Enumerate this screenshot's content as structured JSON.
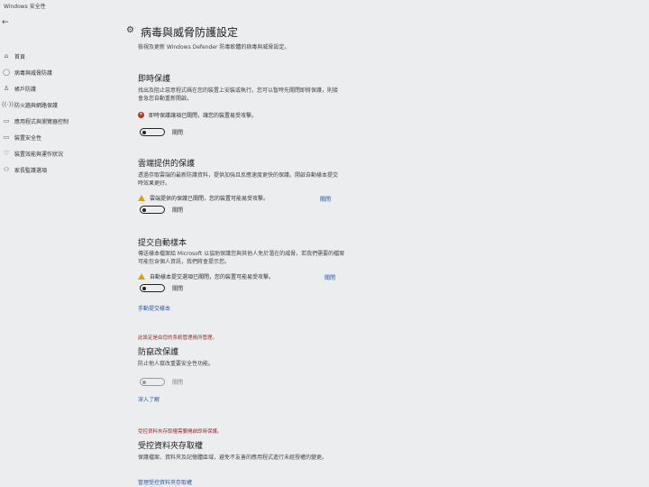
{
  "window": {
    "title": "Windows 安全性"
  },
  "back_icon": "back-arrow-icon",
  "sidebar": {
    "items": [
      {
        "icon": "home-icon",
        "glyph": "⌂",
        "label": "首頁"
      },
      {
        "icon": "shield-icon",
        "glyph": "◯",
        "label": "病毒與威脅防護"
      },
      {
        "icon": "person-icon",
        "glyph": "♙",
        "label": "帳戶防護"
      },
      {
        "icon": "network-icon",
        "glyph": "((·))",
        "label": "防火牆與網路保護"
      },
      {
        "icon": "app-browser-icon",
        "glyph": "▭",
        "label": "應用程式與瀏覽器控制"
      },
      {
        "icon": "device-security-icon",
        "glyph": "▭",
        "label": "裝置安全性"
      },
      {
        "icon": "heart-icon",
        "glyph": "♡",
        "label": "裝置效能與運作狀況"
      },
      {
        "icon": "family-icon",
        "glyph": "⚇",
        "label": "家長監護選項"
      }
    ]
  },
  "page": {
    "icon": "settings-icon",
    "title": "病毒與威脅防護設定",
    "subtitle": "檢視及更新 Windows Defender 防毒軟體的病毒與威脅設定。"
  },
  "realtime": {
    "title": "即時保護",
    "desc": "找出及阻止惡意程式碼在您的裝置上安裝或執行。您可以暫時先關閉即將保護，則接會急您自動重新開啟。",
    "warning_icon": "error-x-icon",
    "warning": "即時保護讓項已關閉，讓您的裝置易受攻擊。",
    "toggle_state": "關閉"
  },
  "cloud": {
    "title": "雲端提供的保護",
    "desc": "透過存取雲端的最新防護資料，提供加強且反應速度更快的保護。開啟自動樣本提交時效果更好。",
    "warning_icon": "warning-triangle-icon",
    "warning": "雲端提供的保護已關閉，您的裝置可能易受攻擊。",
    "dismiss": "關閉",
    "toggle_state": "關閉"
  },
  "sample": {
    "title": "提交自動樣本",
    "desc": "傳送樣本檔案給 Microsoft 以協助保護您與其他人免於潛在的威脅。若我們需要的檔案可能包含個人資訊，我們將會提示您。",
    "warning_icon": "warning-triangle-icon",
    "warning": "自動樣本提交選項已關閉，您的裝置可能易受攻擊。",
    "dismiss": "關閉",
    "toggle_state": "關閉",
    "link": "手動提交樣本"
  },
  "tamper": {
    "admin_notice": "此設定是由您的系統管理員所管理。",
    "title": "防竄改保護",
    "desc": "防止他人竄改重要安全性功能。",
    "toggle_state": "關閉",
    "link": "深入了解"
  },
  "folder": {
    "admin_notice": "受控資料夾存取權需要開啟即時保護。",
    "title": "受控資料夾存取權",
    "desc": "保護檔案、資料夾及記憶體區域，避免不友善的應用程式進行未經授權的變更。",
    "link": "管理受控資料夾存取權"
  }
}
